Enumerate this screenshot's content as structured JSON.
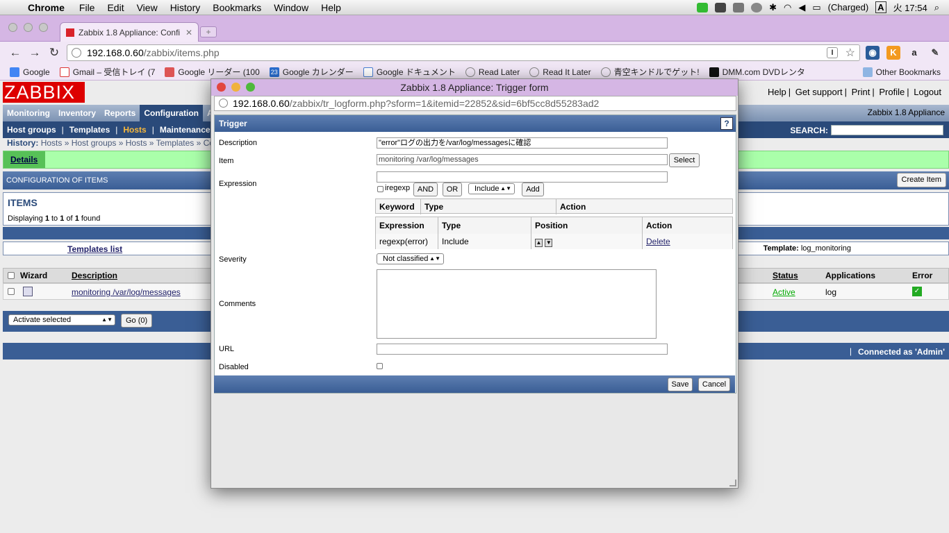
{
  "menubar": {
    "app": "Chrome",
    "items": [
      "File",
      "Edit",
      "View",
      "History",
      "Bookmarks",
      "Window",
      "Help"
    ],
    "battery": "(Charged)",
    "input_method": "A",
    "clock": "火 17:54"
  },
  "browser": {
    "tab_title": "Zabbix 1.8 Appliance: Confi",
    "url_host": "192.168.0.60",
    "url_path": "/zabbix/items.php",
    "bookmarks": [
      "Google",
      "Gmail – 受信トレイ (7",
      "Google リーダー (100",
      "Google カレンダー",
      "Google ドキュメント",
      "Read Later",
      "Read It Later",
      "青空キンドルでゲット!",
      "DMM.com DVDレンタ"
    ],
    "other_bookmarks": "Other Bookmarks",
    "calendar_day": "23"
  },
  "zabbix": {
    "logo": "ZABBIX",
    "toplinks": [
      "Help",
      "Get support",
      "Print",
      "Profile",
      "Logout"
    ],
    "main_menu": [
      "Monitoring",
      "Inventory",
      "Reports",
      "Configuration",
      "A"
    ],
    "app_name": "Zabbix 1.8 Appliance",
    "sub_menu": [
      "Host groups",
      "Templates",
      "Hosts",
      "Maintenance"
    ],
    "search_label": "SEARCH:",
    "history_label": "History:",
    "history": [
      "Hosts",
      "Host groups",
      "Hosts",
      "Templates",
      "Co"
    ],
    "details": "Details",
    "config_title": "CONFIGURATION OF ITEMS",
    "create_item": "Create Item",
    "items_title": "ITEMS",
    "displaying": {
      "pre": "Displaying",
      "from": "1",
      "to_word": "to",
      "to": "1",
      "of_word": "of",
      "total": "1",
      "post": "found"
    },
    "templates_list": "Templates list",
    "template_label": "Template:",
    "template_name": "log_monitoring",
    "table_headers": [
      "Wizard",
      "Description",
      "Status",
      "Applications",
      "Error"
    ],
    "row": {
      "description": "monitoring /var/log/messages",
      "status": "Active",
      "applications": "log"
    },
    "action_select": "Activate selected",
    "go_button": "Go (0)",
    "footer_pipe": "|",
    "connected": "Connected as 'Admin'"
  },
  "popup": {
    "title": "Zabbix 1.8 Appliance: Trigger form",
    "url_host": "192.168.0.60",
    "url_path": "/zabbix/tr_logform.php?sform=1&itemid=22852&sid=6bf5cc8d55283ad2",
    "header": "Trigger",
    "help": "?",
    "labels": {
      "description": "Description",
      "item": "Item",
      "expression": "Expression",
      "severity": "Severity",
      "comments": "Comments",
      "url": "URL",
      "disabled": "Disabled"
    },
    "description_value": "\"error\"ログの出力を/var/log/messagesに確認",
    "item_value": "monitoring /var/log/messages",
    "select_button": "Select",
    "expression_value": "",
    "iregexp": "iregexp",
    "and_button": "AND",
    "or_button": "OR",
    "include_select": "Include",
    "add_button": "Add",
    "kw_headers": [
      "Keyword",
      "Type",
      "Action"
    ],
    "expr_headers": [
      "Expression",
      "Type",
      "Position",
      "Action"
    ],
    "expr_row": {
      "expression": "regexp(error)",
      "type": "Include",
      "action": "Delete"
    },
    "severity_value": "Not classified",
    "url_value": "",
    "save": "Save",
    "cancel": "Cancel"
  }
}
